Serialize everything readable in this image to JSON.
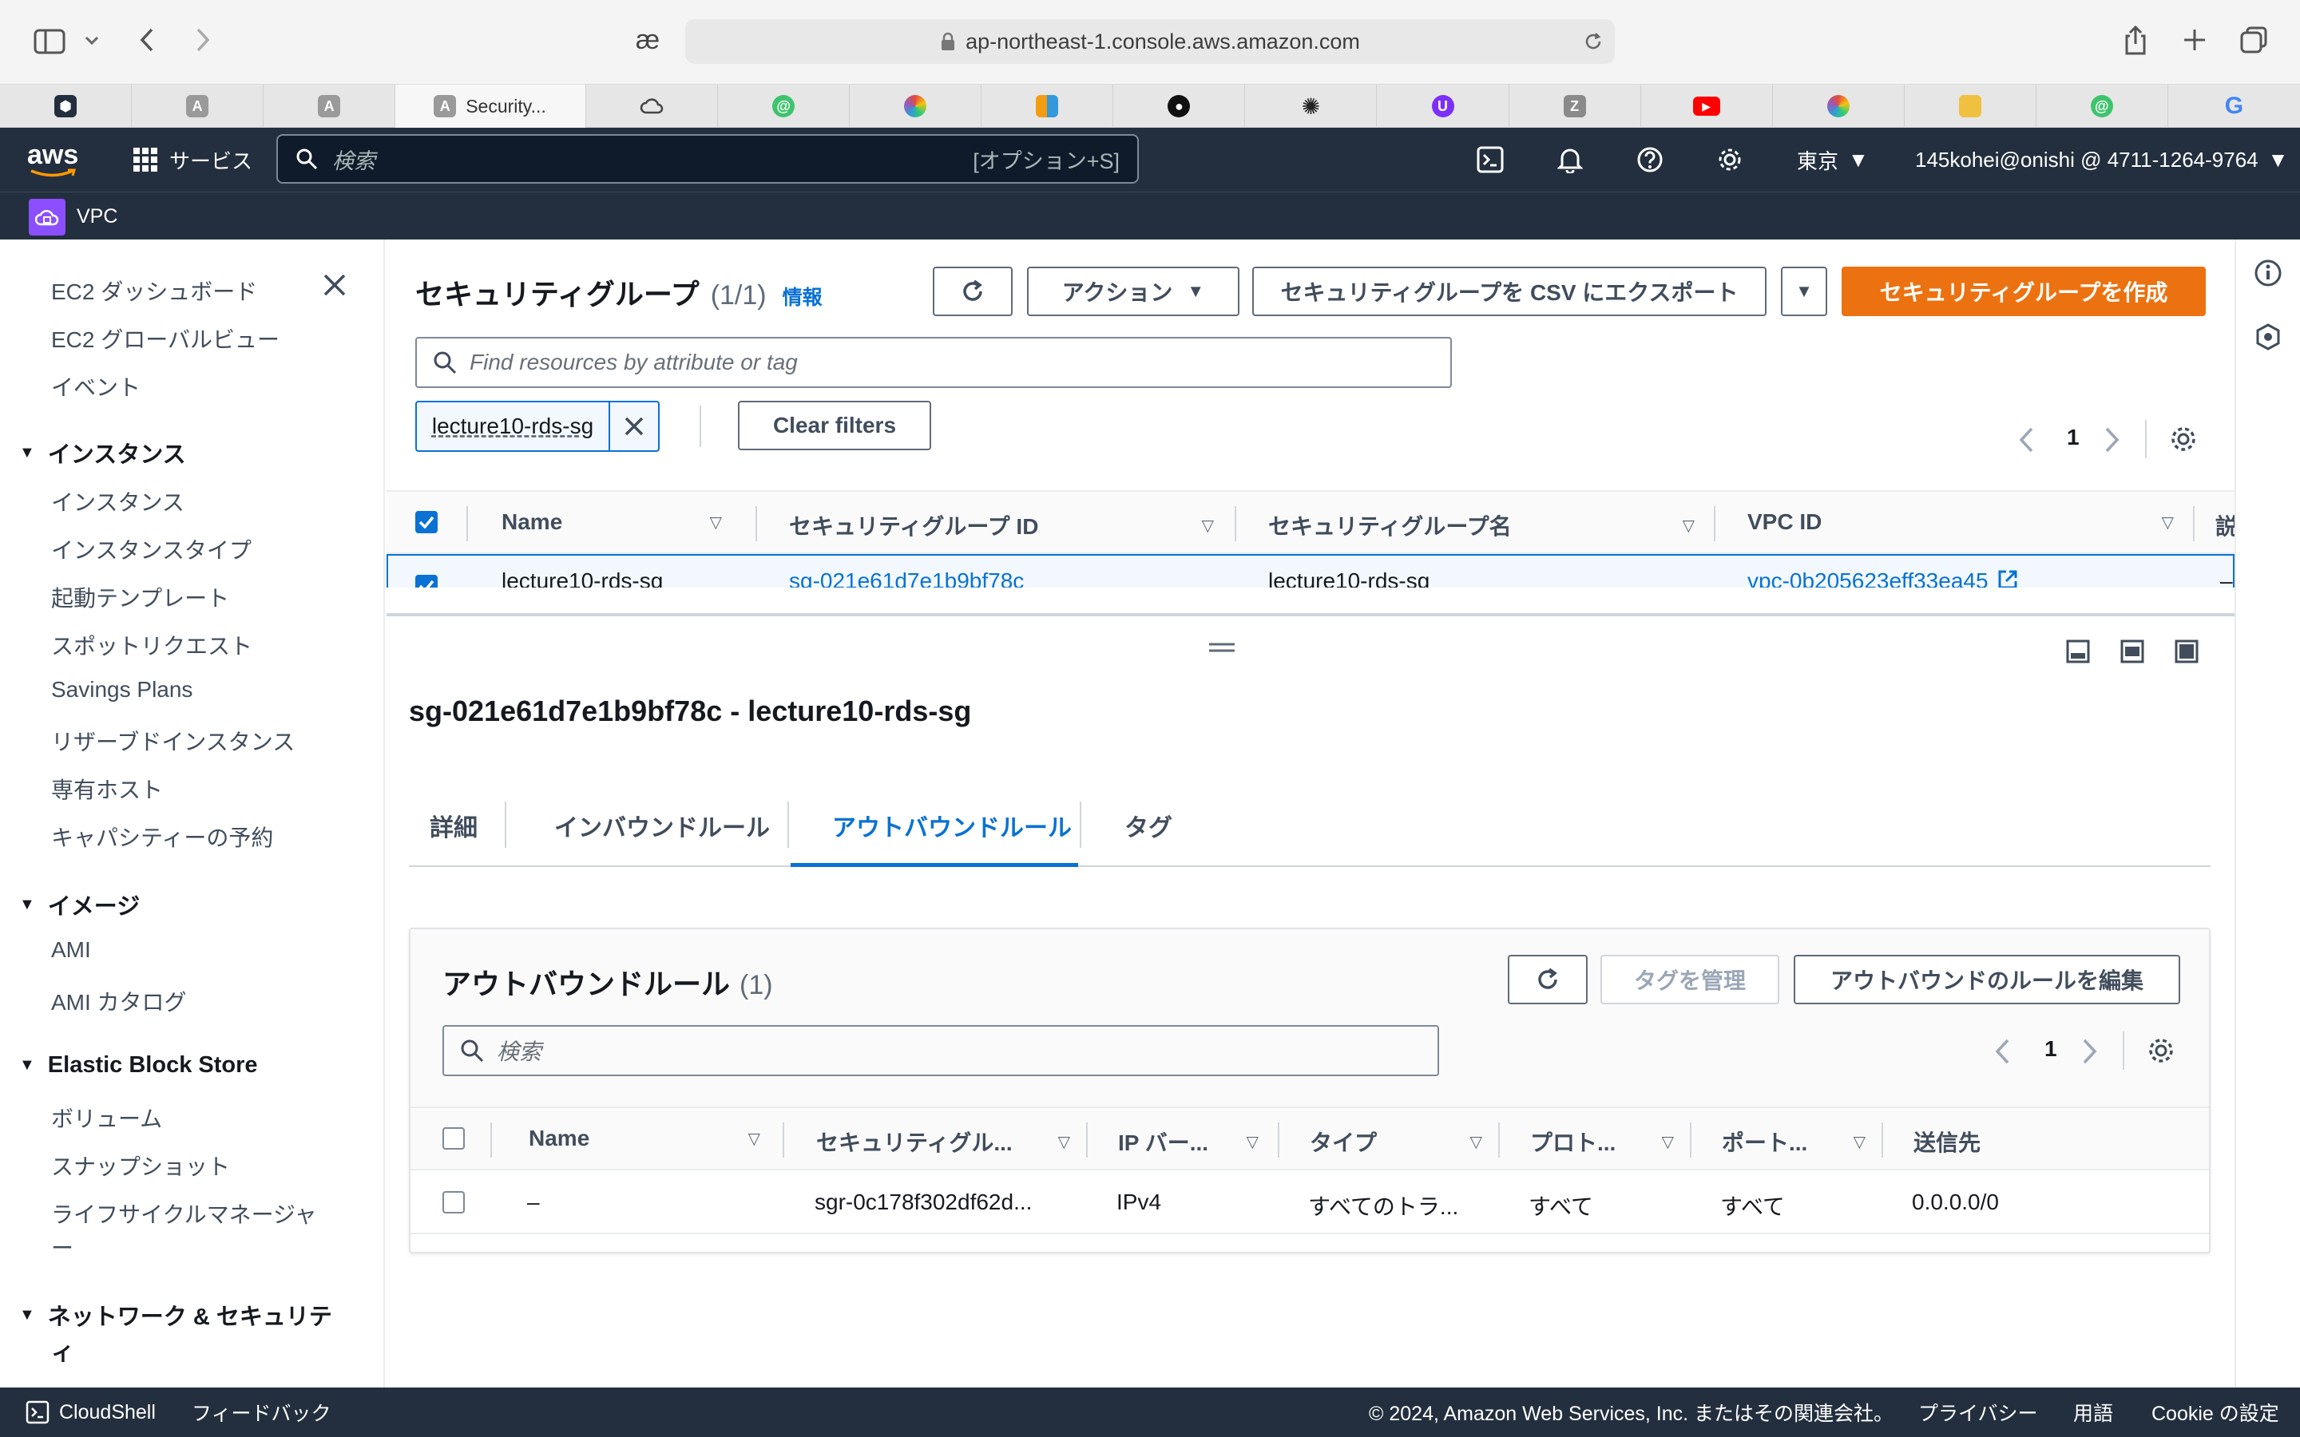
{
  "browser": {
    "url": "ap-northeast-1.console.aws.amazon.com",
    "active_tab_title": "Security...",
    "tab_icons": [
      "shield-icon",
      "a-letter-icon",
      "a-letter-icon",
      "security-tab-icon",
      "cloud-icon",
      "green-circle-icon",
      "pinwheel-icon",
      "grid-icon",
      "github-icon",
      "openai-icon",
      "u-letter-icon",
      "z-letter-icon",
      "youtube-icon",
      "pinwheel-icon",
      "box-icon",
      "green-circle-icon",
      "google-icon"
    ]
  },
  "aws_nav": {
    "logo": "aws",
    "services_label": "サービス",
    "search_placeholder": "検索",
    "search_shortcut": "[オプション+S]",
    "region": "東京",
    "account": "145kohei@onishi @ 4711-1264-9764",
    "service_name": "VPC"
  },
  "sidebar": {
    "top_items": [
      "EC2 ダッシュボード",
      "EC2 グローバルビュー",
      "イベント"
    ],
    "sections": [
      {
        "title": "インスタンス",
        "items": [
          "インスタンス",
          "インスタンスタイプ",
          "起動テンプレート",
          "スポットリクエスト",
          "Savings Plans",
          "リザーブドインスタンス",
          "専有ホスト",
          "キャパシティーの予約"
        ]
      },
      {
        "title": "イメージ",
        "items": [
          "AMI",
          "AMI カタログ"
        ]
      },
      {
        "title": "Elastic Block Store",
        "items": [
          "ボリューム",
          "スナップショット",
          "ライフサイクルマネージャ",
          "ー"
        ]
      },
      {
        "title": "ネットワーク & セキュリテ",
        "title2": "ィ",
        "items": []
      }
    ]
  },
  "sg_list": {
    "title": "セキュリティグループ",
    "count": "(1/1)",
    "info_link": "情報",
    "actions_label": "アクション",
    "export_label": "セキュリティグループを CSV にエクスポート",
    "create_label": "セキュリティグループを作成",
    "filter_placeholder": "Find resources by attribute or tag",
    "filter_token": "lecture10-rds-sg",
    "clear_filters": "Clear filters",
    "page": "1",
    "columns": [
      "Name",
      "セキュリティグループ ID",
      "セキュリティグループ名",
      "VPC ID",
      "説"
    ],
    "row": {
      "name": "lecture10-rds-sg",
      "sg_id": "sg-021e61d7e1b9bf78c",
      "sg_name": "lecture10-rds-sg",
      "vpc_id": "vpc-0b205623eff33ea45",
      "extra": "–"
    }
  },
  "detail": {
    "heading": "sg-021e61d7e1b9bf78c - lecture10-rds-sg",
    "tabs": [
      "詳細",
      "インバウンドルール",
      "アウトバウンドルール",
      "タグ"
    ],
    "active_tab": 2
  },
  "outbound": {
    "title": "アウトバウンドルール",
    "count": "(1)",
    "manage_tags": "タグを管理",
    "edit_rules": "アウトバウンドのルールを編集",
    "search_placeholder": "検索",
    "page": "1",
    "columns": [
      "Name",
      "セキュリティグル...",
      "IP バー...",
      "タイプ",
      "プロト...",
      "ポート...",
      "送信先"
    ],
    "rows": [
      {
        "name": "–",
        "rule_id": "sgr-0c178f302df62d...",
        "ip": "IPv4",
        "type": "すべてのトラ...",
        "protocol": "すべて",
        "port": "すべて",
        "dest": "0.0.0.0/0"
      }
    ]
  },
  "footer": {
    "cloudshell": "CloudShell",
    "feedback": "フィードバック",
    "copyright": "© 2024, Amazon Web Services, Inc. またはその関連会社。",
    "privacy": "プライバシー",
    "terms": "用語",
    "cookie": "Cookie の設定"
  },
  "colors": {
    "nav_bg": "#232f3e",
    "primary": "#ec7211",
    "link": "#0972d3",
    "text": "#16191f"
  }
}
